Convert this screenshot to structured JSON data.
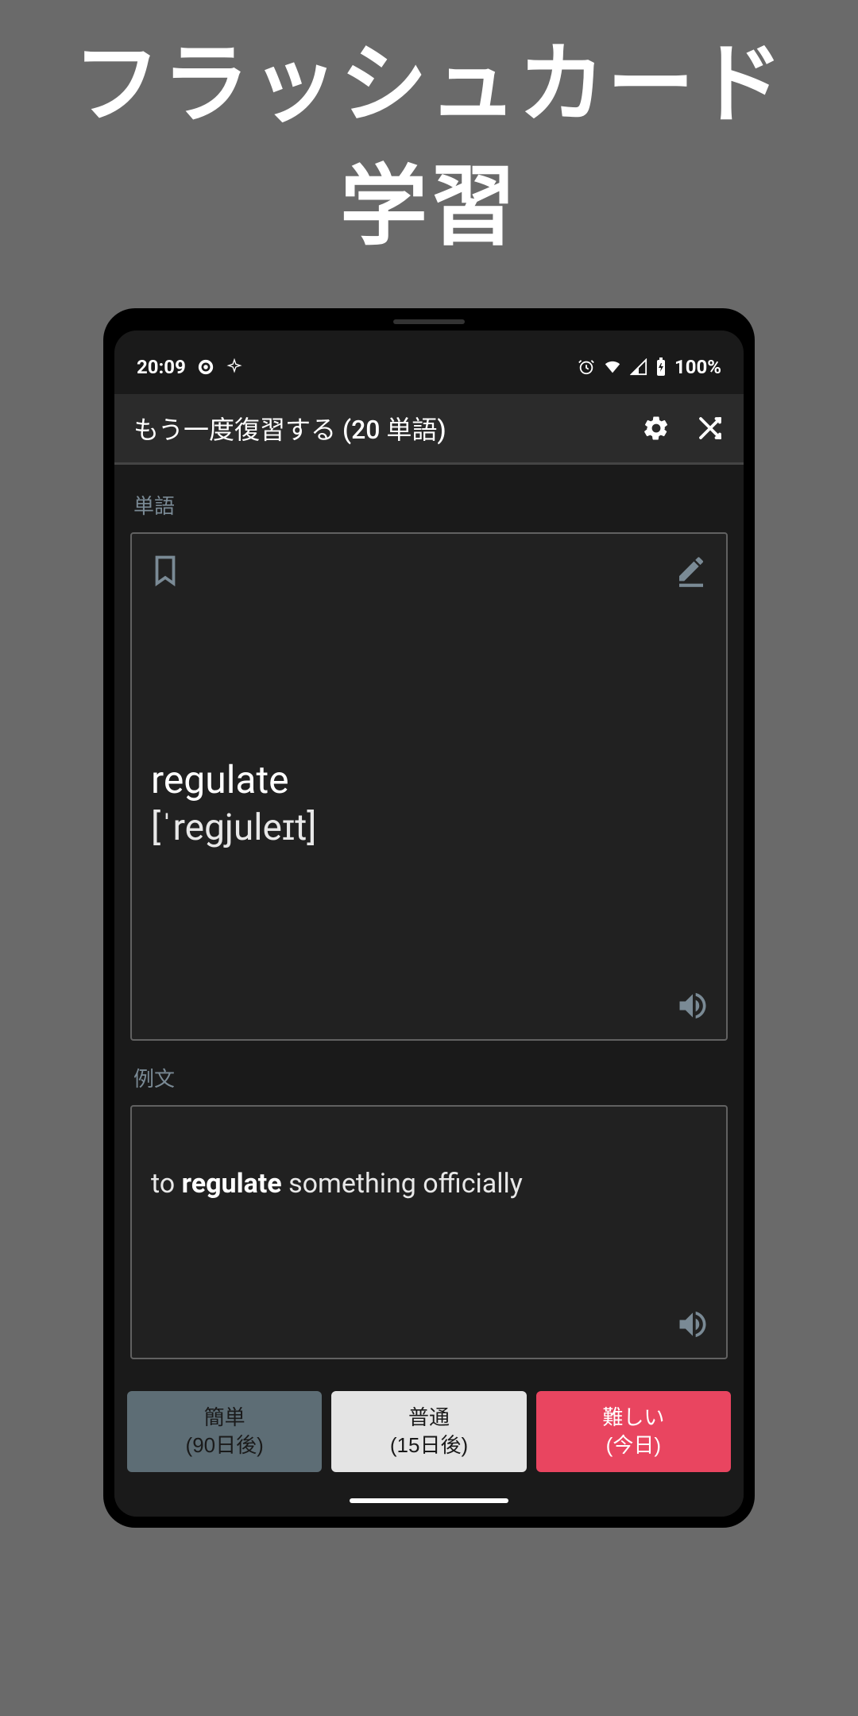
{
  "promo": {
    "line1": "フラッシュカード",
    "line2": "学習"
  },
  "status": {
    "time": "20:09",
    "battery_pct": "100%"
  },
  "appbar": {
    "title": "もう一度復習する (20 単語)"
  },
  "sections": {
    "word_label": "単語",
    "example_label": "例文"
  },
  "card": {
    "word": "regulate",
    "phonetic": "[ˈregjuleɪt]"
  },
  "example": {
    "prefix": "to ",
    "bold": "regulate",
    "suffix": " something officially"
  },
  "buttons": {
    "easy": {
      "label": "簡単",
      "sub": "(90日後)"
    },
    "normal": {
      "label": "普通",
      "sub": "(15日後)"
    },
    "hard": {
      "label": "難しい",
      "sub": "(今日)"
    }
  }
}
